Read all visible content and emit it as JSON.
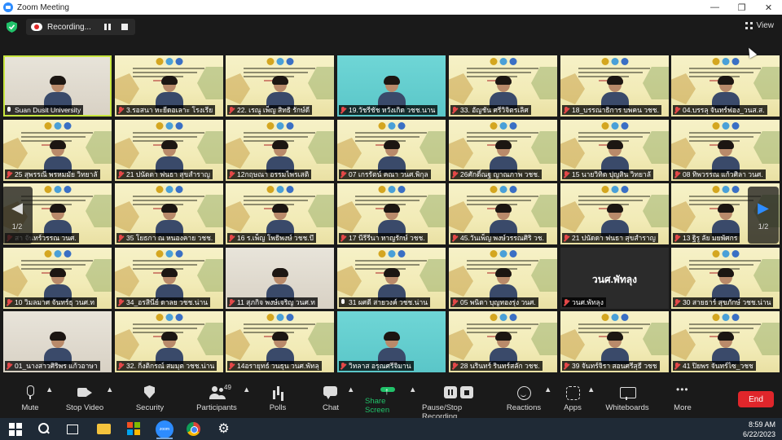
{
  "window": {
    "title": "Zoom Meeting"
  },
  "top_bar": {
    "recording_label": "Recording...",
    "view_label": "View"
  },
  "gallery": {
    "page_indicator": "1/2",
    "tiles": [
      {
        "label": "Suan Dusit University",
        "type": "cam",
        "mic": "on",
        "active": true
      },
      {
        "label": "3.รอสนา หะยีดอเลาะ โรงเรีย",
        "type": "slide",
        "mic": "muted"
      },
      {
        "label": "22. เรณู เพ็ญ สิทธิ รักษ์ดี",
        "type": "slide",
        "mic": "muted"
      },
      {
        "label": "19.วัชรีชัช หวังเกิด วชช.นาน",
        "type": "cyan",
        "mic": "muted"
      },
      {
        "label": "33. อัญชัน ศรีวิจิตรเลิศ",
        "type": "slide",
        "mic": "muted"
      },
      {
        "label": "18_บรรณาธิการ บพคน วชช.",
        "type": "slide",
        "mic": "muted"
      },
      {
        "label": "04.บรรลุ จันทร์ฟอง_วนส.ส.",
        "type": "slide",
        "mic": "muted"
      },
      {
        "label": "25 สุพรรณี พรหมมัย วิทยาลั",
        "type": "slide",
        "mic": "muted"
      },
      {
        "label": "21 ปนัดดา ฟนธา สุขสำราญ",
        "type": "slide",
        "mic": "muted"
      },
      {
        "label": "12กฤษณา อรรมไพรเสติ",
        "type": "slide",
        "mic": "muted"
      },
      {
        "label": "07 เกรรัตน์ คณา วนศ.พิกุล",
        "type": "slide",
        "mic": "muted"
      },
      {
        "label": "26ศักดิ์ณฐ ญาณภาพ วชช.",
        "type": "slide",
        "mic": "muted"
      },
      {
        "label": "15 นายวิทิต ปุญสิน วิทยาลั",
        "type": "slide",
        "mic": "muted"
      },
      {
        "label": "08 ทิพวรรณ แก้วศิลา วนศ.",
        "type": "slide",
        "mic": "muted"
      },
      {
        "label": "สา จันทร์วรรณ วนศ.",
        "type": "slide",
        "mic": "muted"
      },
      {
        "label": "35 โยธกา ณ หนองคาย วชช.",
        "type": "slide",
        "mic": "muted"
      },
      {
        "label": "16 ร.เพ็ญ โพธิพงษ์ วชช.บึ",
        "type": "slide",
        "mic": "muted"
      },
      {
        "label": "17 นีรีรีนา หาญรักษ์ วชช.",
        "type": "slide",
        "mic": "muted"
      },
      {
        "label": "45.วันเพ็ญ พงษ์วรรณศิริ วช.",
        "type": "slide",
        "mic": "muted"
      },
      {
        "label": "21 ปนัดดา ฟนธา สุขสำราญ",
        "type": "slide",
        "mic": "muted"
      },
      {
        "label": "13 ฐิรู ลัย มยพัศกร",
        "type": "slide",
        "mic": "muted"
      },
      {
        "label": "10 วิมลมาศ จันทร์ธุ วนศ.ท",
        "type": "slide",
        "mic": "muted"
      },
      {
        "label": "34_อรสินีย์ ดาลย วชช.น่าน",
        "type": "slide",
        "mic": "muted"
      },
      {
        "label": "11 สุภกิจ พงษ์เจริญ วนศ.ท",
        "type": "cam",
        "mic": "muted"
      },
      {
        "label": "31 ผศดี สายวงค์ วชช.น่าน",
        "type": "slide",
        "mic": "on"
      },
      {
        "label": "05 พนิดา บุญทองรุ่ง วนศ.",
        "type": "slide",
        "mic": "muted"
      },
      {
        "label": "วนศ.พัทลุง",
        "type": "dark",
        "mic": "muted",
        "center": "วนศ.พัทลุง"
      },
      {
        "label": "30 สายธาร์ สุขภักษ์ วชช.น่าน",
        "type": "slide",
        "mic": "muted"
      },
      {
        "label": "01_นางสาวศิริพร แก้วอาษา",
        "type": "cam",
        "mic": "muted"
      },
      {
        "label": "32. กิ่งติกรณ์ สมมุต วชช.น่าน",
        "type": "slide",
        "mic": "muted"
      },
      {
        "label": "14อรายุทธ์ วนธุน วนศ.พัทลุ",
        "type": "slide",
        "mic": "muted"
      },
      {
        "label": "วิทลาส อรุณศรีจิมาน",
        "type": "cyan",
        "mic": "muted"
      },
      {
        "label": "28 นรินทร์ รินทร์สลัก วชช.",
        "type": "slide",
        "mic": "muted"
      },
      {
        "label": "39 จันทร์จิรา สอนศรีสุธี วชช",
        "type": "slide",
        "mic": "muted"
      },
      {
        "label": "41 ปิยพร จันทร์ไซ_วชช",
        "type": "slide",
        "mic": "muted"
      }
    ]
  },
  "toolbar": {
    "mute": "Mute",
    "stop_video": "Stop Video",
    "security": "Security",
    "participants": "Participants",
    "participant_count": "49",
    "polls": "Polls",
    "chat": "Chat",
    "share_screen": "Share Screen",
    "pause_stop_recording": "Pause/Stop Recording",
    "reactions": "Reactions",
    "apps": "Apps",
    "whiteboards": "Whiteboards",
    "more": "More",
    "end": "End"
  },
  "taskbar": {
    "time": "8:59 AM",
    "date": "6/22/2023",
    "zoom_icon_text": "zoom"
  },
  "colors": {
    "accent": "#2d8cff",
    "share_green": "#21c26a",
    "end_red": "#e0262b",
    "active_outline": "#c8e640"
  }
}
